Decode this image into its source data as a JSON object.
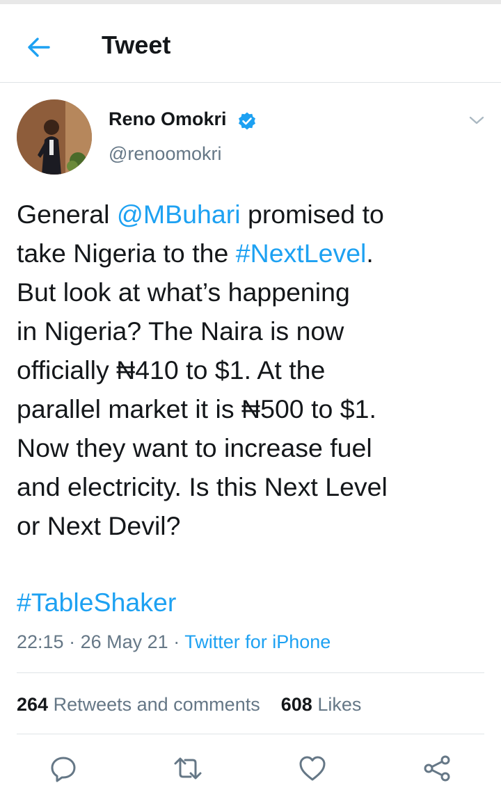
{
  "header": {
    "title": "Tweet"
  },
  "author": {
    "name": "Reno Omokri",
    "handle": "@renoomokri",
    "verified": true
  },
  "tweet": {
    "lines": [
      [
        {
          "t": "General "
        },
        {
          "t": "@MBuhari",
          "link": true
        },
        {
          "t": " promised to"
        }
      ],
      [
        {
          "t": "take Nigeria to the "
        },
        {
          "t": "#NextLevel",
          "link": true
        },
        {
          "t": "."
        }
      ],
      [
        {
          "t": "But look at what’s happening"
        }
      ],
      [
        {
          "t": "in Nigeria? The Naira is now"
        }
      ],
      [
        {
          "t": "officially ₦410 to $1. At the"
        }
      ],
      [
        {
          "t": "parallel market it is ₦500 to $1."
        }
      ],
      [
        {
          "t": "Now they want to increase fuel"
        }
      ],
      [
        {
          "t": "and electricity. Is this Next Level"
        }
      ],
      [
        {
          "t": "or Next Devil?"
        }
      ]
    ],
    "hashtag": "#TableShaker",
    "time": "22:15",
    "date": "26 May 21",
    "separator": "·",
    "source": "Twitter for iPhone"
  },
  "stats": {
    "retweets_count": "264",
    "retweets_label": "Retweets and comments",
    "likes_count": "608",
    "likes_label": "Likes"
  },
  "colors": {
    "accent": "#1da1f2",
    "text": "#14171a",
    "muted": "#657786",
    "divider": "#dfe3e6"
  },
  "icons": [
    "back-arrow-icon",
    "verified-badge-icon",
    "chevron-down-icon",
    "reply-icon",
    "retweet-icon",
    "like-icon",
    "share-icon"
  ]
}
